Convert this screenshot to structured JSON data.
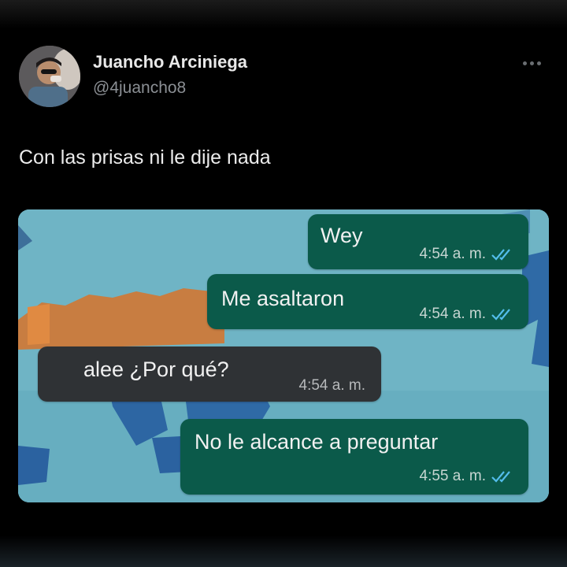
{
  "post": {
    "author_name": "Juancho Arciniega",
    "author_handle": "@4juancho8",
    "text": "Con las prisas ni le dije nada"
  },
  "icons": {
    "more": "more-horizontal-icon",
    "read_receipt": "double-check-icon"
  },
  "colors": {
    "outgoing_bubble": "#0b5a4a",
    "incoming_bubble": "#2f3235",
    "read_ticks": "#53bdeb",
    "background": "#000000"
  },
  "chat": {
    "messages": [
      {
        "direction": "outgoing",
        "text": "Wey",
        "time": "4:54 a. m.",
        "read": true
      },
      {
        "direction": "outgoing",
        "text": "Me asaltaron",
        "time": "4:54 a. m.",
        "read": true
      },
      {
        "direction": "incoming",
        "text": "alee ¿Por qué?",
        "time": "4:54 a. m."
      },
      {
        "direction": "outgoing",
        "text": "No le alcance a preguntar",
        "time": "4:55 a. m.",
        "read": true
      }
    ]
  }
}
